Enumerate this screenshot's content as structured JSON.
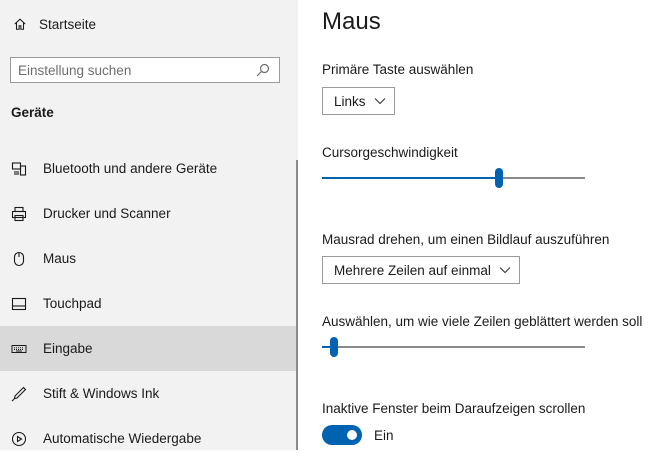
{
  "sidebar": {
    "home": {
      "label": "Startseite",
      "icon": "home-icon"
    },
    "search": {
      "placeholder": "Einstellung suchen",
      "value": "",
      "icon": "search-icon"
    },
    "section_title": "Geräte",
    "items": [
      {
        "label": "Bluetooth und andere Geräte",
        "icon": "bluetooth-devices-icon"
      },
      {
        "label": "Drucker und Scanner",
        "icon": "printer-icon"
      },
      {
        "label": "Maus",
        "icon": "mouse-icon"
      },
      {
        "label": "Touchpad",
        "icon": "touchpad-icon"
      },
      {
        "label": "Eingabe",
        "icon": "keyboard-icon",
        "selected": true
      },
      {
        "label": "Stift & Windows Ink",
        "icon": "pen-icon"
      },
      {
        "label": "Automatische Wiedergabe",
        "icon": "autoplay-icon"
      }
    ]
  },
  "main": {
    "title": "Maus",
    "primary_button": {
      "label": "Primäre Taste auswählen",
      "value": "Links"
    },
    "cursor_speed": {
      "label": "Cursorgeschwindigkeit",
      "value_fraction": 0.68
    },
    "wheel": {
      "label": "Mausrad drehen, um einen Bildlauf auszuführen",
      "value": "Mehrere Zeilen auf einmal"
    },
    "lines": {
      "label": "Auswählen, um wie viele Zeilen geblättert werden soll",
      "value_fraction": 0.03
    },
    "inactive_scroll": {
      "label": "Inaktive Fenster beim Daraufzeigen scrollen",
      "state_label": "Ein",
      "on": true
    }
  },
  "colors": {
    "accent": "#0063b1",
    "sidebar_bg": "#f2f2f2",
    "selected_bg": "#d9d9d9"
  }
}
